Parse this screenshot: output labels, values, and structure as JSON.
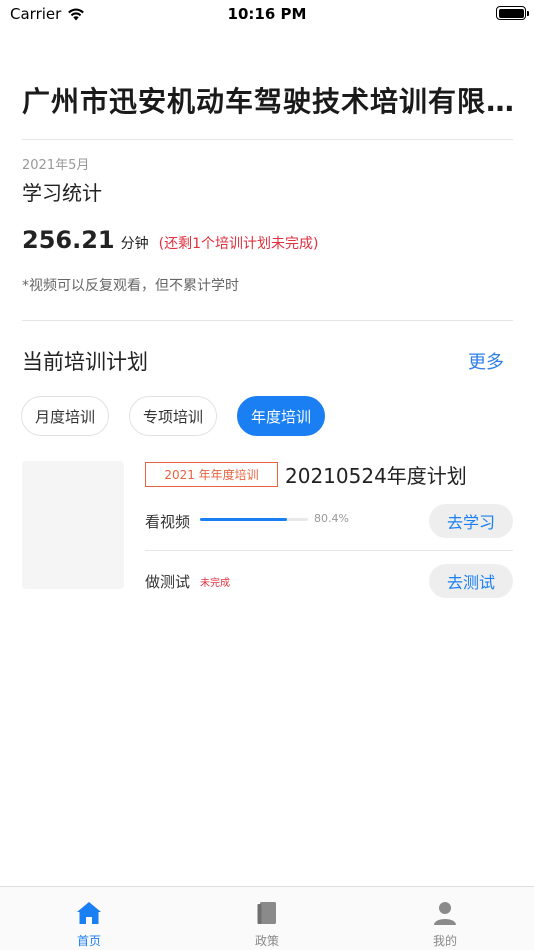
{
  "status_bar": {
    "carrier": "Carrier",
    "time": "10:16 PM"
  },
  "company": {
    "title": "广州市迅安机动车驾驶技术培训有限..."
  },
  "stats": {
    "month": "2021年5月",
    "title": "学习统计",
    "minutes": "256.21",
    "unit": "分钟",
    "remaining_note": "(还剩1个培训计划未完成)",
    "video_note": "*视频可以反复观看，但不累计学时"
  },
  "plans": {
    "title": "当前培训计划",
    "more": "更多",
    "tabs": [
      {
        "label": "月度培训",
        "active": false
      },
      {
        "label": "专项培训",
        "active": false
      },
      {
        "label": "年度培训",
        "active": true
      }
    ],
    "current": {
      "badge": "2021 年年度培训",
      "name": "20210524年度计划",
      "video": {
        "label": "看视频",
        "progress": 80.4,
        "progress_text": "80.4%",
        "button": "去学习"
      },
      "test": {
        "label": "做测试",
        "status": "未完成",
        "button": "去测试"
      }
    }
  },
  "tabbar": {
    "items": [
      {
        "label": "首页",
        "icon": "home-icon",
        "active": true
      },
      {
        "label": "政策",
        "icon": "book-icon",
        "active": false
      },
      {
        "label": "我的",
        "icon": "person-icon",
        "active": false
      }
    ]
  },
  "colors": {
    "accent": "#1a7ff2",
    "warning": "#e0313f",
    "badge": "#e8633f"
  }
}
